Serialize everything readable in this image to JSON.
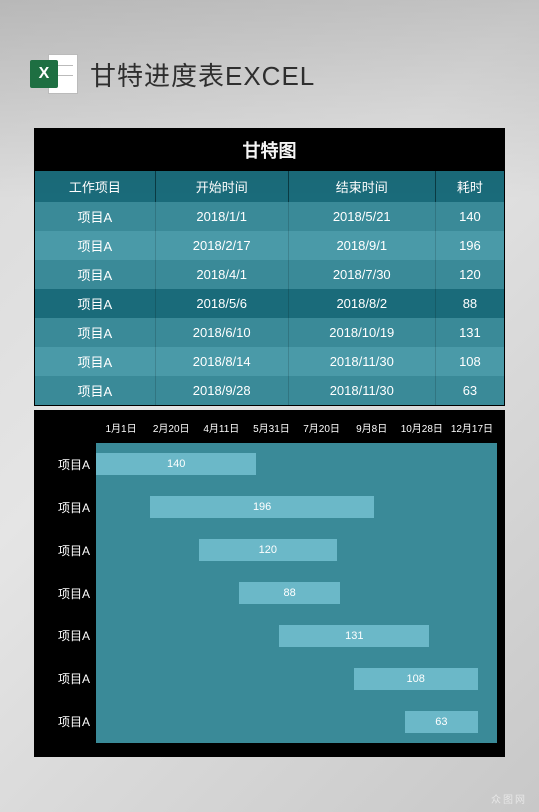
{
  "header": {
    "icon_letter": "X",
    "title": "甘特进度表EXCEL"
  },
  "table": {
    "title": "甘特图",
    "columns": [
      "工作项目",
      "开始时间",
      "结束时间",
      "耗时"
    ],
    "rows": [
      {
        "name": "项目A",
        "start": "2018/1/1",
        "end": "2018/5/21",
        "duration": "140"
      },
      {
        "name": "项目A",
        "start": "2018/2/17",
        "end": "2018/9/1",
        "duration": "196"
      },
      {
        "name": "项目A",
        "start": "2018/4/1",
        "end": "2018/7/30",
        "duration": "120"
      },
      {
        "name": "项目A",
        "start": "2018/5/6",
        "end": "2018/8/2",
        "duration": "88"
      },
      {
        "name": "项目A",
        "start": "2018/6/10",
        "end": "2018/10/19",
        "duration": "131"
      },
      {
        "name": "项目A",
        "start": "2018/8/14",
        "end": "2018/11/30",
        "duration": "108"
      },
      {
        "name": "项目A",
        "start": "2018/9/28",
        "end": "2018/11/30",
        "duration": "63"
      }
    ]
  },
  "chart_data": {
    "type": "bar",
    "orientation": "horizontal-gantt",
    "title": "甘特图",
    "xlabel": "",
    "ylabel": "",
    "x_ticks": [
      "1月1日",
      "2月20日",
      "4月11日",
      "5月31日",
      "7月20日",
      "9月8日",
      "10月28日",
      "12月17日"
    ],
    "x_range_days": [
      0,
      350
    ],
    "categories": [
      "项目A",
      "项目A",
      "项目A",
      "项目A",
      "项目A",
      "项目A",
      "项目A"
    ],
    "series": [
      {
        "name": "项目A",
        "start_day": 0,
        "duration": 140,
        "label": "140"
      },
      {
        "name": "项目A",
        "start_day": 47,
        "duration": 196,
        "label": "196"
      },
      {
        "name": "项目A",
        "start_day": 90,
        "duration": 120,
        "label": "120"
      },
      {
        "name": "项目A",
        "start_day": 125,
        "duration": 88,
        "label": "88"
      },
      {
        "name": "项目A",
        "start_day": 160,
        "duration": 131,
        "label": "131"
      },
      {
        "name": "项目A",
        "start_day": 225,
        "duration": 108,
        "label": "108"
      },
      {
        "name": "项目A",
        "start_day": 270,
        "duration": 63,
        "label": "63"
      }
    ]
  },
  "colors": {
    "header_teal": "#1a6b7a",
    "row_teal": "#3a8a98",
    "row_teal_alt": "#4a9aa8",
    "bar_light": "#6bb8c8",
    "black": "#000000"
  },
  "watermark": "众图网"
}
